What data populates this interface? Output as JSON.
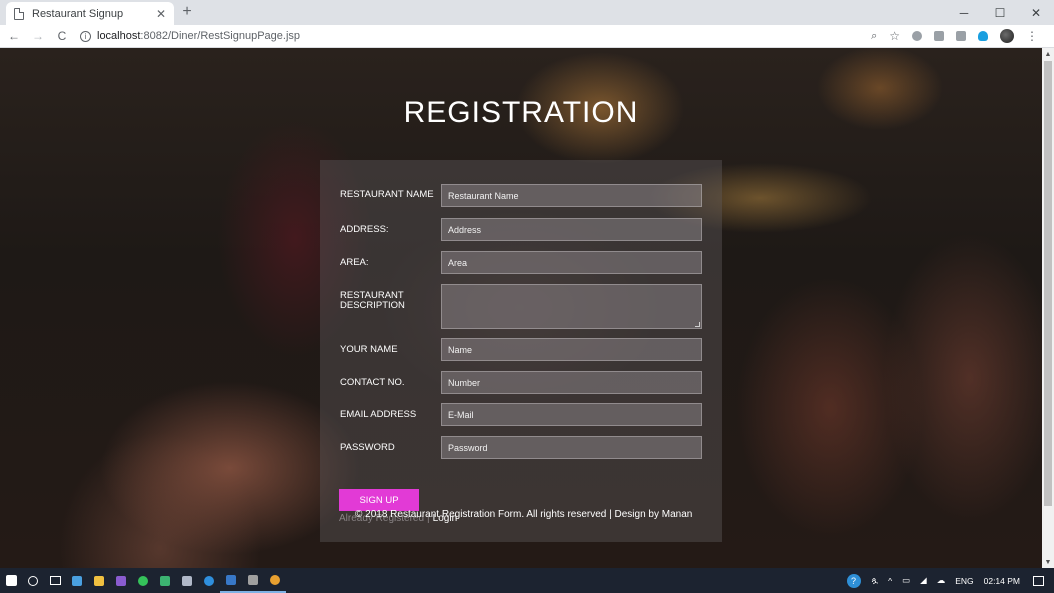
{
  "browser": {
    "tab_title": "Restaurant Signup",
    "tab_close": "✕",
    "new_tab": "+",
    "url_host": "localhost",
    "url_rest": ":8082/Diner/RestSignupPage.jsp",
    "window_controls": {
      "minimize": "─",
      "maximize": "☐",
      "close": "✕"
    }
  },
  "page": {
    "title": "REGISTRATION",
    "fields": {
      "restaurant_name": {
        "label": "RESTAURANT NAME",
        "placeholder": "Restaurant Name"
      },
      "address": {
        "label": "ADDRESS:",
        "placeholder": "Address"
      },
      "area": {
        "label": "AREA:",
        "placeholder": "Area"
      },
      "description": {
        "label_line1": "RESTAURANT",
        "label_line2": "DESCRIPTION",
        "placeholder": ""
      },
      "your_name": {
        "label": "YOUR NAME",
        "placeholder": "Name"
      },
      "contact": {
        "label": "CONTACT NO.",
        "placeholder": "Number"
      },
      "email": {
        "label": "EMAIL ADDRESS",
        "placeholder": "E-Mail"
      },
      "password": {
        "label": "PASSWORD",
        "placeholder": "Password"
      }
    },
    "signup_label": "SIGN UP",
    "already_registered": "Already Registered",
    "separator": "|",
    "login_label": "Login",
    "footer": "© 2018 Restaurant Registration Form. All rights reserved | Design by Manan"
  },
  "taskbar": {
    "tray": {
      "people": "ጷ",
      "chevron": "^",
      "language": "ENG",
      "time": "02:14 PM"
    }
  },
  "colors": {
    "signup_button": "#e23ad6",
    "taskbar": "#1c2330"
  }
}
